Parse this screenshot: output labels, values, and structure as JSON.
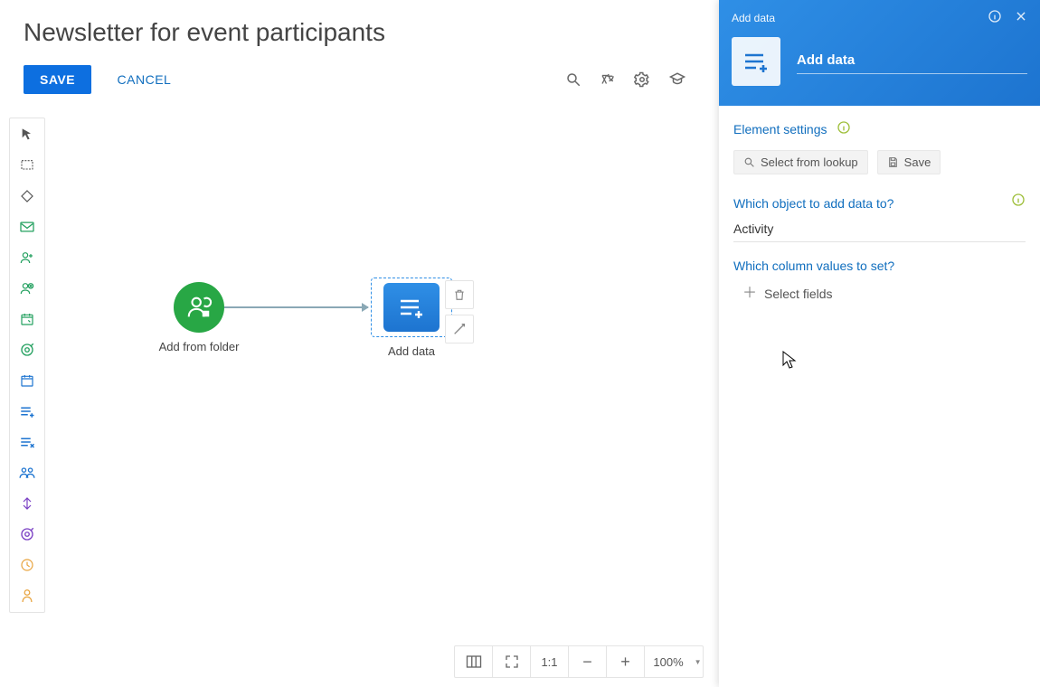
{
  "header": {
    "title": "Newsletter for event participants",
    "save_label": "SAVE",
    "cancel_label": "CANCEL"
  },
  "canvas": {
    "node1_label": "Add from folder",
    "node2_label": "Add data"
  },
  "zoom": {
    "scale_label": "1:1",
    "percent": "100%"
  },
  "panel": {
    "header_small": "Add data",
    "title_value": "Add data",
    "element_settings": "Element settings",
    "lookup_label": "Select from lookup",
    "save_label": "Save",
    "q_object": "Which object to add data to?",
    "object_value": "Activity",
    "q_columns": "Which column values to set?",
    "select_fields": "Select fields"
  }
}
